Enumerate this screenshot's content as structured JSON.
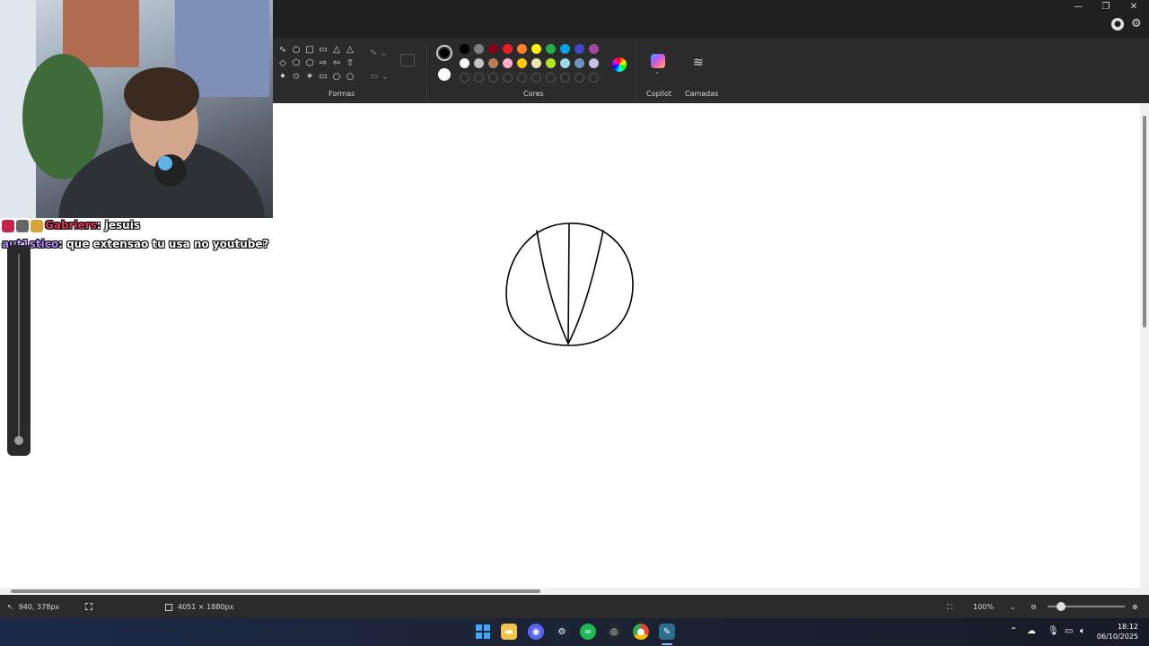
{
  "window": {
    "minimize": "—",
    "restore": "❐",
    "close": "✕",
    "account_icon": "account-icon",
    "settings_icon": "gear-icon"
  },
  "ribbon": {
    "shapes_label": "Formas",
    "colors_label": "Cores",
    "copilot_label": "Copilot",
    "layers_label": "Camadas",
    "shapes": [
      "∿",
      "○",
      "□",
      "▭",
      "△",
      "△",
      "◇",
      "⬠",
      "⬡",
      "⇨",
      "⇦",
      "⇧",
      "✦",
      "✩",
      "✶",
      "▭",
      "○",
      "○"
    ],
    "palette_row1": [
      "#000000",
      "#7f7f7f",
      "#880015",
      "#ed1c24",
      "#ff7f27",
      "#fff200",
      "#22b14c",
      "#00a2e8",
      "#3f48cc",
      "#a349a4"
    ],
    "palette_row2": [
      "#ffffff",
      "#c3c3c3",
      "#b97a57",
      "#ffaec9",
      "#ffc90e",
      "#efe4b0",
      "#b5e61d",
      "#99d9ea",
      "#7092be",
      "#c8bfe7"
    ],
    "primary_color": "#000000",
    "secondary_color": "#ffffff"
  },
  "status": {
    "cursor_pos": "940, 378px",
    "canvas_size": "4051 × 1880px",
    "zoom": "100%"
  },
  "taskbar": {
    "time": "18:12",
    "date": "06/10/2025",
    "apps": [
      "windows-start",
      "file-explorer",
      "discord",
      "steam",
      "spotify",
      "github",
      "chrome",
      "paint"
    ]
  },
  "chat": {
    "line1_name": "Gabriers",
    "line1_msg": "jesuis",
    "line2_name": "aut1stico",
    "line2_msg": "que extensao tu usa no youtube?"
  }
}
